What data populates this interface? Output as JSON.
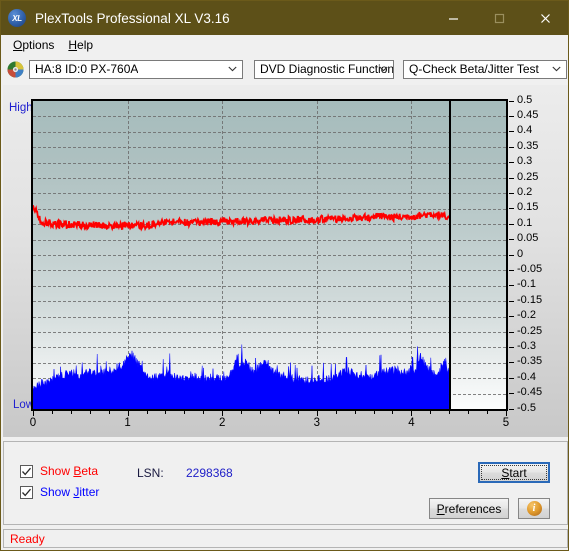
{
  "window": {
    "title": "PlexTools Professional XL V3.16",
    "icon": "XL",
    "icon_name": "plextools-logo-icon",
    "controls": {
      "minimize": "minimize-icon",
      "maximize": "maximize-icon",
      "close": "close-icon"
    },
    "titlebar_color": "#5d5018"
  },
  "menu": {
    "items": [
      {
        "label": "Options",
        "accel": "O"
      },
      {
        "label": "Help",
        "accel": "H"
      }
    ]
  },
  "toolbar": {
    "drive_combo": {
      "value": "HA:8 ID:0  PX-760A",
      "icon": "disc-icon"
    },
    "function_combo": {
      "value": "DVD Diagnostic Functions"
    },
    "test_combo": {
      "value": "Q-Check Beta/Jitter Test"
    }
  },
  "chart_data": {
    "type": "line",
    "title": "Q-Check Beta/Jitter Test",
    "xlabel": "",
    "ylabel": "",
    "left_axis_top_label": "High",
    "left_axis_bottom_label": "Low",
    "grid": true,
    "legend_position": "below-left",
    "xlim": [
      0,
      5
    ],
    "ylim": [
      -0.5,
      0.5
    ],
    "xticks": [
      0,
      1,
      2,
      3,
      4,
      5
    ],
    "yticks": [
      0.5,
      0.45,
      0.4,
      0.35,
      0.3,
      0.25,
      0.2,
      0.15,
      0.1,
      0.05,
      0,
      -0.05,
      -0.1,
      -0.15,
      -0.2,
      -0.25,
      -0.3,
      -0.35,
      -0.4,
      -0.45,
      -0.5
    ],
    "ytick_labels": [
      "0.5",
      "0.45",
      "0.4",
      "0.35",
      "0.3",
      "0.25",
      "0.2",
      "0.15",
      "0.1",
      "0.05",
      "0",
      "-0.05",
      "-0.1",
      "-0.15",
      "-0.2",
      "-0.25",
      "-0.3",
      "-0.35",
      "-0.4",
      "-0.45",
      "-0.5"
    ],
    "data_end_x": 4.4,
    "cursor_x": 4.4,
    "series": [
      {
        "name": "Beta",
        "color": "#ff0000",
        "style": "noisy-line",
        "noise": 0.012,
        "x": [
          0.0,
          0.04,
          0.08,
          0.12,
          0.2,
          0.3,
          0.4,
          0.5,
          0.6,
          0.7,
          0.8,
          0.9,
          1.0,
          1.1,
          1.2,
          1.3,
          1.4,
          1.5,
          1.6,
          1.7,
          1.8,
          1.9,
          2.0,
          2.1,
          2.2,
          2.3,
          2.4,
          2.5,
          2.6,
          2.7,
          2.8,
          2.9,
          3.0,
          3.1,
          3.2,
          3.3,
          3.4,
          3.5,
          3.6,
          3.7,
          3.8,
          3.9,
          4.0,
          4.1,
          4.2,
          4.3,
          4.38,
          4.4
        ],
        "values": [
          0.15,
          0.139,
          0.11,
          0.104,
          0.101,
          0.1,
          0.099,
          0.098,
          0.098,
          0.097,
          0.097,
          0.096,
          0.096,
          0.096,
          0.097,
          0.1,
          0.106,
          0.107,
          0.106,
          0.106,
          0.107,
          0.108,
          0.108,
          0.109,
          0.11,
          0.111,
          0.111,
          0.112,
          0.113,
          0.113,
          0.114,
          0.115,
          0.116,
          0.117,
          0.118,
          0.119,
          0.12,
          0.121,
          0.124,
          0.126,
          0.122,
          0.123,
          0.126,
          0.129,
          0.133,
          0.13,
          0.118,
          0.106
        ]
      },
      {
        "name": "Jitter",
        "color": "#0000ff",
        "style": "filled-noise-area",
        "baseline": -0.5,
        "x": [
          0.0,
          0.05,
          0.1,
          0.15,
          0.2,
          0.25,
          0.3,
          0.35,
          0.4,
          0.45,
          0.5,
          0.55,
          0.6,
          0.65,
          0.7,
          0.75,
          0.8,
          0.85,
          0.9,
          0.95,
          1.0,
          1.05,
          1.1,
          1.15,
          1.2,
          1.25,
          1.3,
          1.35,
          1.4,
          1.45,
          1.5,
          1.55,
          1.6,
          1.65,
          1.7,
          1.75,
          1.8,
          1.85,
          1.9,
          1.95,
          2.0,
          2.05,
          2.1,
          2.15,
          2.2,
          2.25,
          2.3,
          2.35,
          2.4,
          2.45,
          2.5,
          2.55,
          2.6,
          2.65,
          2.7,
          2.75,
          2.8,
          2.85,
          2.9,
          2.95,
          3.0,
          3.05,
          3.1,
          3.15,
          3.2,
          3.25,
          3.3,
          3.35,
          3.4,
          3.45,
          3.5,
          3.55,
          3.6,
          3.65,
          3.7,
          3.75,
          3.8,
          3.85,
          3.9,
          3.95,
          4.0,
          4.05,
          4.1,
          4.15,
          4.2,
          4.25,
          4.3,
          4.35,
          4.4
        ],
        "values": [
          -0.43,
          -0.424,
          -0.418,
          -0.42,
          -0.412,
          -0.404,
          -0.398,
          -0.392,
          -0.386,
          -0.392,
          -0.398,
          -0.39,
          -0.384,
          -0.388,
          -0.39,
          -0.386,
          -0.382,
          -0.376,
          -0.368,
          -0.36,
          -0.34,
          -0.328,
          -0.352,
          -0.374,
          -0.394,
          -0.398,
          -0.4,
          -0.394,
          -0.392,
          -0.388,
          -0.4,
          -0.404,
          -0.406,
          -0.4,
          -0.396,
          -0.404,
          -0.408,
          -0.406,
          -0.402,
          -0.404,
          -0.408,
          -0.4,
          -0.38,
          -0.346,
          -0.364,
          -0.352,
          -0.378,
          -0.386,
          -0.366,
          -0.35,
          -0.372,
          -0.38,
          -0.392,
          -0.396,
          -0.402,
          -0.406,
          -0.408,
          -0.41,
          -0.412,
          -0.408,
          -0.404,
          -0.408,
          -0.41,
          -0.406,
          -0.398,
          -0.388,
          -0.374,
          -0.382,
          -0.39,
          -0.396,
          -0.392,
          -0.398,
          -0.396,
          -0.39,
          -0.386,
          -0.382,
          -0.378,
          -0.376,
          -0.382,
          -0.386,
          -0.38,
          -0.372,
          -0.334,
          -0.364,
          -0.38,
          -0.388,
          -0.382,
          -0.35,
          -0.392
        ]
      }
    ]
  },
  "controls": {
    "show_beta": {
      "label": "Show Beta",
      "accel": "B",
      "checked": true,
      "color": "#ff0000"
    },
    "show_jitter": {
      "label": "Show Jitter",
      "accel": "J",
      "checked": true,
      "color": "#0000ff"
    },
    "lsn_label": "LSN:",
    "lsn_value": "2298368",
    "start_button": "Start",
    "start_accel": "S",
    "preferences_button": "Preferences",
    "preferences_accel": "P",
    "info_button": "i"
  },
  "statusbar": {
    "text": "Ready",
    "color": "#ff0000"
  }
}
